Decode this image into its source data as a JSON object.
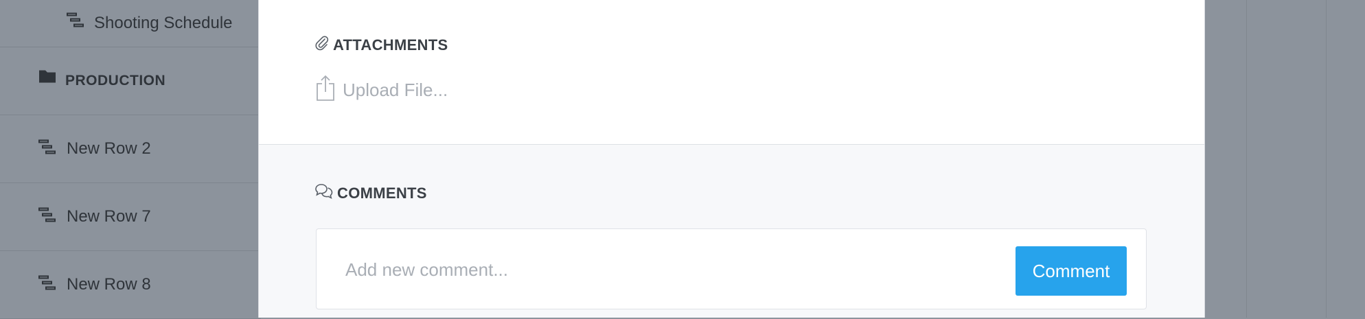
{
  "sidebar": {
    "items": [
      {
        "label": "Shooting Schedule",
        "icon": "gantt-icon",
        "kind": "row"
      },
      {
        "label": "PRODUCTION",
        "icon": "folder-icon",
        "kind": "folder"
      },
      {
        "label": "New Row 2",
        "icon": "gantt-icon",
        "kind": "row"
      },
      {
        "label": "New Row 7",
        "icon": "gantt-icon",
        "kind": "row"
      },
      {
        "label": "New Row 8",
        "icon": "gantt-icon",
        "kind": "row"
      }
    ]
  },
  "attachments": {
    "title": "ATTACHMENTS",
    "icon": "paperclip-icon",
    "upload_label": "Upload File...",
    "upload_icon": "upload-icon"
  },
  "comments": {
    "title": "COMMENTS",
    "icon": "speech-bubbles-icon",
    "placeholder": "Add new comment...",
    "button_label": "Comment",
    "button_color": "#27a3ec"
  },
  "colors": {
    "overlay_bg": "#8c939c",
    "text_dark": "#3b4046",
    "text_muted": "#a9aeb5"
  }
}
